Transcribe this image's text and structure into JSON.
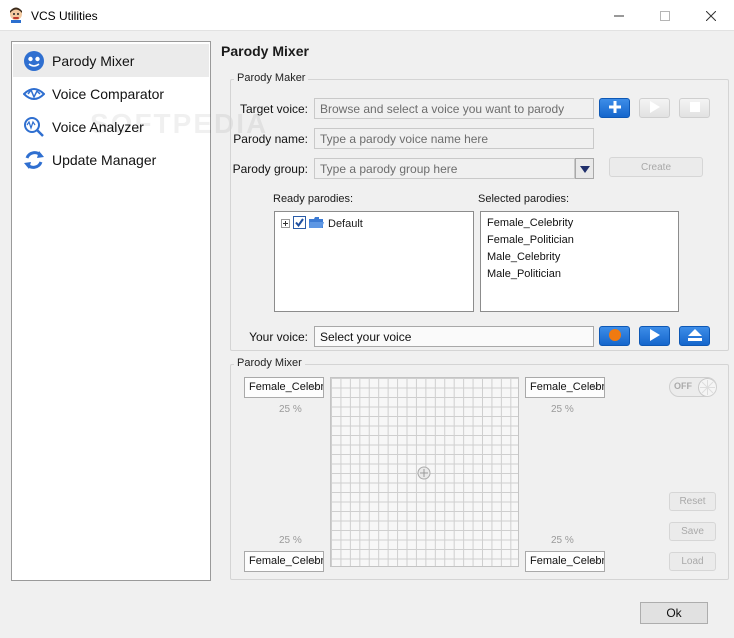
{
  "window": {
    "title": "VCS Utilities"
  },
  "sidebar": {
    "items": [
      {
        "label": "Parody Mixer",
        "icon": "parody-mixer-icon",
        "selected": true
      },
      {
        "label": "Voice Comparator",
        "icon": "voice-comparator-icon",
        "selected": false
      },
      {
        "label": "Voice Analyzer",
        "icon": "voice-analyzer-icon",
        "selected": false
      },
      {
        "label": "Update Manager",
        "icon": "update-manager-icon",
        "selected": false
      }
    ]
  },
  "watermark": "SOFTPEDIA",
  "page": {
    "title": "Parody Mixer"
  },
  "parody_maker": {
    "group_label": "Parody Maker",
    "target_voice": {
      "label": "Target voice:",
      "placeholder": "Browse and select a voice you want to parody"
    },
    "parody_name": {
      "label": "Parody name:",
      "placeholder": "Type a parody voice name here"
    },
    "parody_group": {
      "label": "Parody group:",
      "placeholder": "Type a parody group here"
    },
    "create_label": "Create",
    "ready_parodies": {
      "label": "Ready parodies:",
      "tree": [
        {
          "label": "Default",
          "checked": true
        }
      ]
    },
    "selected_parodies": {
      "label": "Selected parodies:",
      "items": [
        "Female_Celebrity",
        "Female_Politician",
        "Male_Celebrity",
        "Male_Politician"
      ]
    },
    "your_voice": {
      "label": "Your voice:",
      "value": "Select your voice"
    }
  },
  "parody_mixer": {
    "group_label": "Parody Mixer",
    "top_left": {
      "value": "Female_Celebrity",
      "percent": "25 %"
    },
    "top_right": {
      "value": "Female_Celebrity",
      "percent": "25 %"
    },
    "bottom_left": {
      "value": "Female_Celebrity",
      "percent": "25 %"
    },
    "bottom_right": {
      "value": "Female_Celebrity",
      "percent": "25 %"
    },
    "toggle_label": "OFF",
    "reset_label": "Reset",
    "save_label": "Save",
    "load_label": "Load"
  },
  "footer": {
    "ok_label": "Ok"
  },
  "colors": {
    "accent_blue": "#1566cc",
    "record_orange": "#f07a10"
  }
}
